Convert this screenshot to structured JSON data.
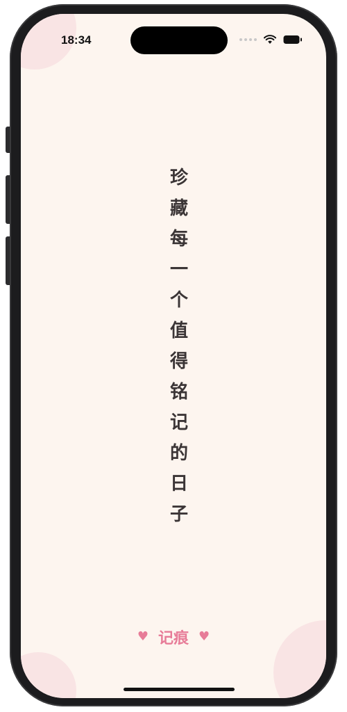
{
  "status_bar": {
    "time": "18:34",
    "icons": [
      "signal-dots-icon",
      "wifi-icon",
      "battery-icon"
    ]
  },
  "slogan": {
    "characters": [
      "珍",
      "藏",
      "每",
      "一",
      "个",
      "值",
      "得",
      "铭",
      "记",
      "的",
      "日",
      "子"
    ]
  },
  "brand": {
    "name": "记痕",
    "left_icon": "heart-icon",
    "right_icon": "heart-icon",
    "heart_glyph": "♥"
  },
  "colors": {
    "background": "#fdf5ef",
    "accent_pink": "#e77c98",
    "text_dark": "#3b3536",
    "decor_blob": "#f9e4e4"
  }
}
